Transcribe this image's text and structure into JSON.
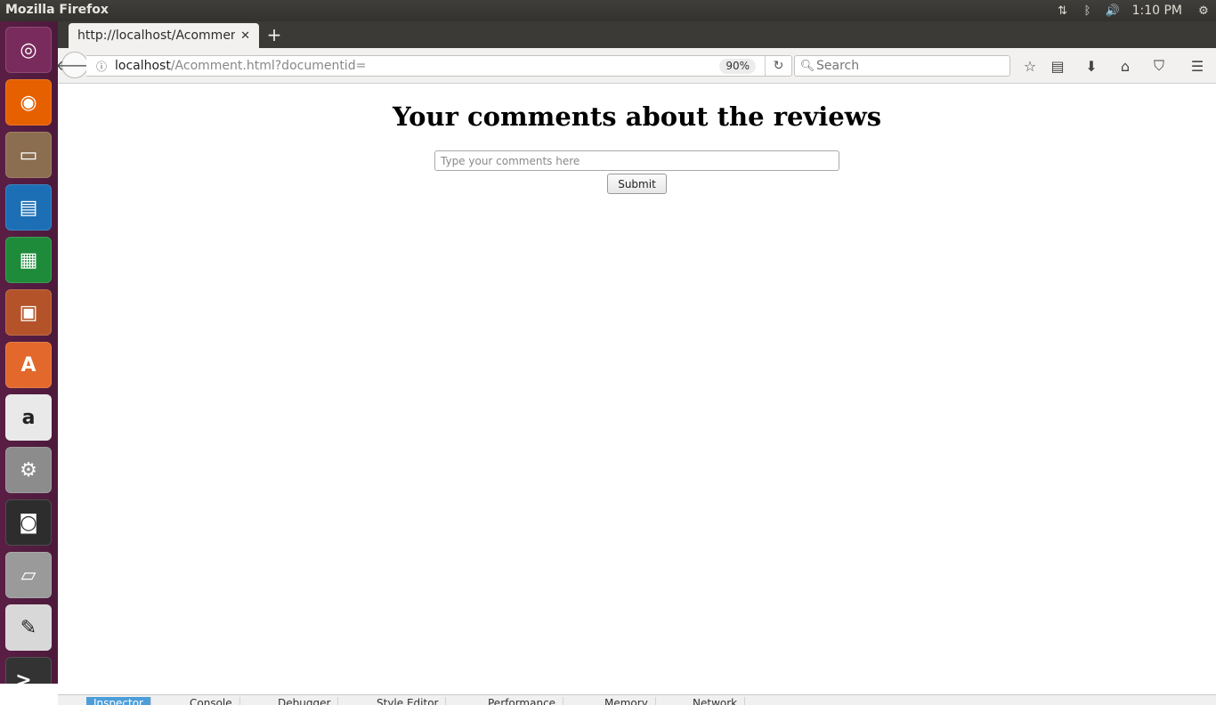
{
  "system": {
    "window_title": "Mozilla Firefox",
    "clock": "1:10 PM",
    "indicators": [
      "network-icon",
      "bluetooth-icon",
      "volume-icon",
      "settings-gear-icon"
    ]
  },
  "launcher": {
    "items": [
      {
        "name": "ubuntu-dash",
        "icon": "ubuntu-logo-icon",
        "color": "#7a2b5d"
      },
      {
        "name": "firefox",
        "icon": "firefox-icon",
        "color": "#e66000"
      },
      {
        "name": "files",
        "icon": "file-cabinet-icon",
        "color": "#8b6d4f"
      },
      {
        "name": "writer",
        "icon": "writer-document-icon",
        "color": "#1c6fb5"
      },
      {
        "name": "calc",
        "icon": "calc-spreadsheet-icon",
        "color": "#1e8b3a"
      },
      {
        "name": "impress",
        "icon": "impress-presentation-icon",
        "color": "#b4532a"
      },
      {
        "name": "software-center",
        "icon": "shopping-bag-icon",
        "color": "#e2682c"
      },
      {
        "name": "amazon",
        "icon": "amazon-icon",
        "color": "#e9e9e9"
      },
      {
        "name": "system-settings",
        "icon": "wrench-gear-icon",
        "color": "#8c8c8c"
      },
      {
        "name": "disk-manager",
        "icon": "safe-icon",
        "color": "#2d2d2d"
      },
      {
        "name": "scanner",
        "icon": "scanner-icon",
        "color": "#9a9a9a"
      },
      {
        "name": "text-editor",
        "icon": "text-editor-icon",
        "color": "#d8d8d8"
      },
      {
        "name": "terminal",
        "icon": "terminal-icon",
        "color": "#333333"
      }
    ]
  },
  "browser": {
    "tab_label": "http://localhost/Acomment.html",
    "url_host": "localhost",
    "url_path": "/Acomment.html?documentid=",
    "zoom": "90%",
    "search_placeholder": "Search"
  },
  "page": {
    "heading": "Your comments about the reviews",
    "input_placeholder": "Type your comments here",
    "submit_label": "Submit"
  },
  "devtools": {
    "tabs": [
      "Inspector",
      "Console",
      "Debugger",
      "Style Editor",
      "Performance",
      "Memory",
      "Network"
    ]
  }
}
